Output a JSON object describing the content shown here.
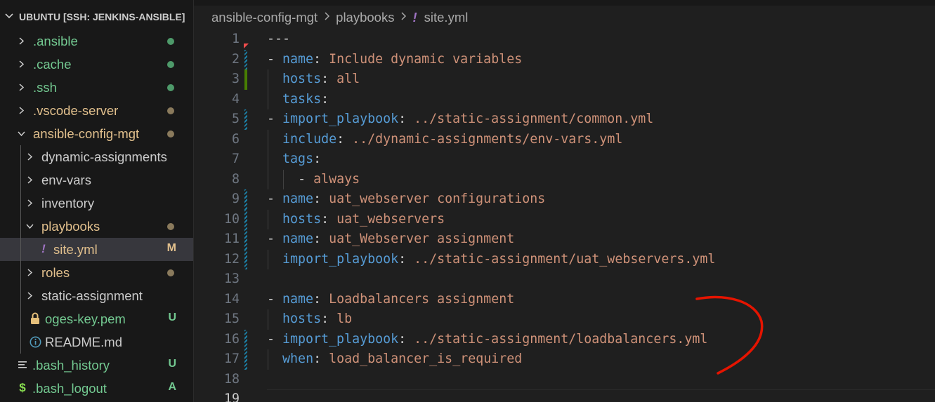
{
  "explorer": {
    "title": "UBUNTU [SSH: JENKINS-ANSIBLE]",
    "items": [
      {
        "label": ".ansible",
        "kind": "folder",
        "expanded": false,
        "depth": 0,
        "status": "dot",
        "color": "#73c991",
        "dot_color": "#4e9a6a"
      },
      {
        "label": ".cache",
        "kind": "folder",
        "expanded": false,
        "depth": 0,
        "status": "dot",
        "color": "#73c991",
        "dot_color": "#4e9a6a"
      },
      {
        "label": ".ssh",
        "kind": "folder",
        "expanded": false,
        "depth": 0,
        "status": "dot",
        "color": "#73c991",
        "dot_color": "#4e9a6a"
      },
      {
        "label": ".vscode-server",
        "kind": "folder",
        "expanded": false,
        "depth": 0,
        "status": "dot",
        "color": "#e2c08d",
        "dot_color": "#8a7a5c"
      },
      {
        "label": "ansible-config-mgt",
        "kind": "folder",
        "expanded": true,
        "depth": 0,
        "status": "dot",
        "color": "#e2c08d",
        "dot_color": "#8a7a5c"
      },
      {
        "label": "dynamic-assignments",
        "kind": "folder",
        "expanded": false,
        "depth": 1,
        "status": "",
        "color": "#cccccc"
      },
      {
        "label": "env-vars",
        "kind": "folder",
        "expanded": false,
        "depth": 1,
        "status": "",
        "color": "#cccccc"
      },
      {
        "label": "inventory",
        "kind": "folder",
        "expanded": false,
        "depth": 1,
        "status": "",
        "color": "#cccccc"
      },
      {
        "label": "playbooks",
        "kind": "folder",
        "expanded": true,
        "depth": 1,
        "status": "dot",
        "color": "#e2c08d",
        "dot_color": "#8a7a5c"
      },
      {
        "label": "site.yml",
        "kind": "file",
        "icon": "!",
        "icon_color": "#a074c4",
        "depth": 2,
        "status": "M",
        "color": "#e2c08d",
        "badge_color": "#e2c08d",
        "selected": true
      },
      {
        "label": "roles",
        "kind": "folder",
        "expanded": false,
        "depth": 1,
        "status": "dot",
        "color": "#e2c08d",
        "dot_color": "#8a7a5c"
      },
      {
        "label": "static-assignment",
        "kind": "folder",
        "expanded": false,
        "depth": 1,
        "status": "",
        "color": "#cccccc"
      },
      {
        "label": "oges-key.pem",
        "kind": "file",
        "icon": "lock",
        "icon_color": "#e6c07b",
        "depth": 1,
        "status": "U",
        "color": "#73c991",
        "badge_color": "#73c991"
      },
      {
        "label": "README.md",
        "kind": "file",
        "icon": "info",
        "icon_color": "#519aba",
        "depth": 1,
        "status": "",
        "color": "#cccccc"
      },
      {
        "label": ".bash_history",
        "kind": "file",
        "icon": "lines",
        "icon_color": "#cccccc",
        "depth": 0,
        "status": "U",
        "color": "#73c991",
        "badge_color": "#73c991"
      },
      {
        "label": ".bash_logout",
        "kind": "file",
        "icon": "$",
        "icon_color": "#89e051",
        "depth": 0,
        "status": "A",
        "color": "#73c991",
        "badge_color": "#73c991"
      }
    ]
  },
  "breadcrumbs": {
    "parts": [
      "ansible-config-mgt",
      "playbooks",
      "site.yml"
    ],
    "file_icon": "!"
  },
  "editor": {
    "current_line": 19,
    "lines": [
      {
        "n": "1",
        "gutter": "",
        "indent": 0,
        "tokens": [
          [
            "p",
            "---"
          ]
        ]
      },
      {
        "n": "2",
        "gutter": "mod",
        "indent": 0,
        "tokens": [
          [
            "p",
            "- "
          ],
          [
            "k",
            "name"
          ],
          [
            "p",
            ": "
          ],
          [
            "s",
            "Include dynamic variables"
          ]
        ]
      },
      {
        "n": "3",
        "gutter": "add",
        "indent": 1,
        "tokens": [
          [
            "k",
            "hosts"
          ],
          [
            "p",
            ": "
          ],
          [
            "s",
            "all"
          ]
        ]
      },
      {
        "n": "4",
        "gutter": "",
        "indent": 1,
        "tokens": [
          [
            "k",
            "tasks"
          ],
          [
            "p",
            ":"
          ]
        ]
      },
      {
        "n": "5",
        "gutter": "mod",
        "indent": 0,
        "tokens": [
          [
            "p",
            "- "
          ],
          [
            "k",
            "import_playbook"
          ],
          [
            "p",
            ": "
          ],
          [
            "s",
            "../static-assignment/common.yml"
          ]
        ]
      },
      {
        "n": "6",
        "gutter": "",
        "indent": 1,
        "tokens": [
          [
            "k",
            "include"
          ],
          [
            "p",
            ": "
          ],
          [
            "s",
            "../dynamic-assignments/env-vars.yml"
          ]
        ]
      },
      {
        "n": "7",
        "gutter": "",
        "indent": 1,
        "tokens": [
          [
            "k",
            "tags"
          ],
          [
            "p",
            ":"
          ]
        ]
      },
      {
        "n": "8",
        "gutter": "",
        "indent": 2,
        "tokens": [
          [
            "p",
            "- "
          ],
          [
            "s",
            "always"
          ]
        ]
      },
      {
        "n": "9",
        "gutter": "mod",
        "indent": 0,
        "tokens": [
          [
            "p",
            "- "
          ],
          [
            "k",
            "name"
          ],
          [
            "p",
            ": "
          ],
          [
            "s",
            "uat_webserver configurations"
          ]
        ]
      },
      {
        "n": "10",
        "gutter": "mod",
        "indent": 1,
        "tokens": [
          [
            "k",
            "hosts"
          ],
          [
            "p",
            ": "
          ],
          [
            "s",
            "uat_webservers"
          ]
        ]
      },
      {
        "n": "11",
        "gutter": "mod",
        "indent": 0,
        "tokens": [
          [
            "p",
            "- "
          ],
          [
            "k",
            "name"
          ],
          [
            "p",
            ": "
          ],
          [
            "s",
            "uat_Webserver assignment"
          ]
        ]
      },
      {
        "n": "12",
        "gutter": "mod",
        "indent": 1,
        "tokens": [
          [
            "k",
            "import_playbook"
          ],
          [
            "p",
            ": "
          ],
          [
            "s",
            "../static-assignment/uat_webservers.yml"
          ]
        ]
      },
      {
        "n": "13",
        "gutter": "",
        "indent": 0,
        "tokens": []
      },
      {
        "n": "14",
        "gutter": "",
        "indent": 0,
        "tokens": [
          [
            "p",
            "- "
          ],
          [
            "k",
            "name"
          ],
          [
            "p",
            ": "
          ],
          [
            "s",
            "Loadbalancers assignment"
          ]
        ]
      },
      {
        "n": "15",
        "gutter": "",
        "indent": 1,
        "tokens": [
          [
            "k",
            "hosts"
          ],
          [
            "p",
            ": "
          ],
          [
            "s",
            "lb"
          ]
        ]
      },
      {
        "n": "16",
        "gutter": "mod",
        "indent": 0,
        "tokens": [
          [
            "p",
            "- "
          ],
          [
            "k",
            "import_playbook"
          ],
          [
            "p",
            ": "
          ],
          [
            "s",
            "../static-assignment/loadbalancers.yml"
          ]
        ]
      },
      {
        "n": "17",
        "gutter": "mod",
        "indent": 1,
        "tokens": [
          [
            "k",
            "when"
          ],
          [
            "p",
            ": "
          ],
          [
            "s",
            "load_balancer_is_required"
          ]
        ]
      },
      {
        "n": "18",
        "gutter": "",
        "indent": 0,
        "tokens": []
      },
      {
        "n": "19",
        "gutter": "",
        "indent": 0,
        "tokens": []
      }
    ]
  },
  "colors": {
    "key": "#569cd6",
    "string": "#ce9178",
    "punct": "#d4d4d4",
    "annotation": "#e51400"
  }
}
